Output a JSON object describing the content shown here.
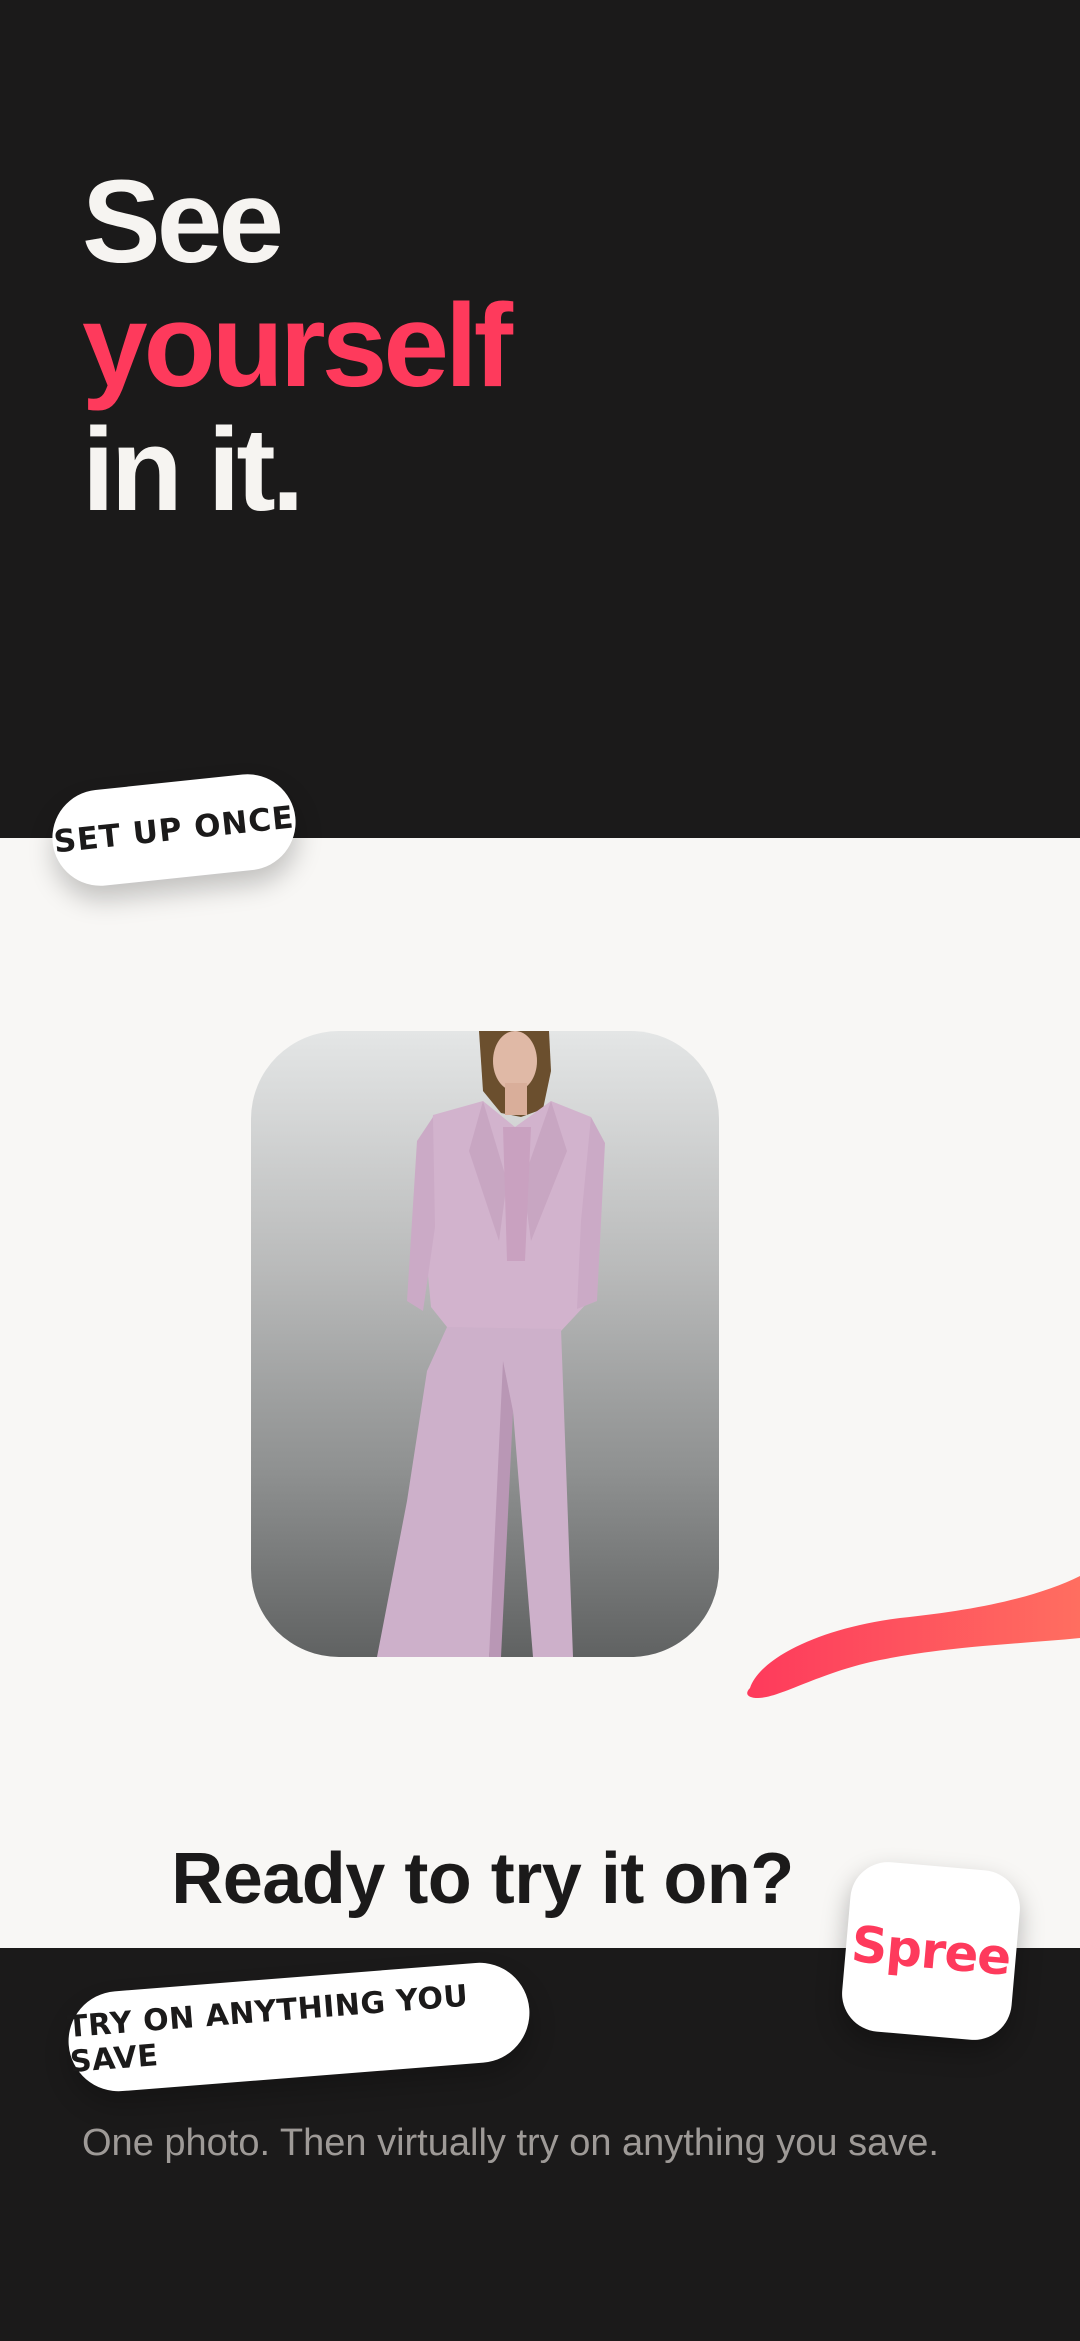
{
  "hero": {
    "line1": "See",
    "line2": "yourself",
    "line3": "in it."
  },
  "badges": {
    "setup": "SET UP ONCE",
    "try_on": "TRY ON ANYTHING YOU SAVE"
  },
  "cta": {
    "title": "Ready to try it on?"
  },
  "app_icon": {
    "label": "Spree"
  },
  "description": "One photo. Then virtually try on anything you save.",
  "colors": {
    "background_dark": "#1b1a1a",
    "background_light": "#f8f7f5",
    "accent": "#fe3a5c",
    "accent_gradient_end": "#ff6e60",
    "text_light": "#f6f4f1",
    "text_muted": "#9e9a97"
  },
  "icons": {
    "model_photo": "model-photo",
    "swoosh": "brush-stroke-decoration"
  }
}
